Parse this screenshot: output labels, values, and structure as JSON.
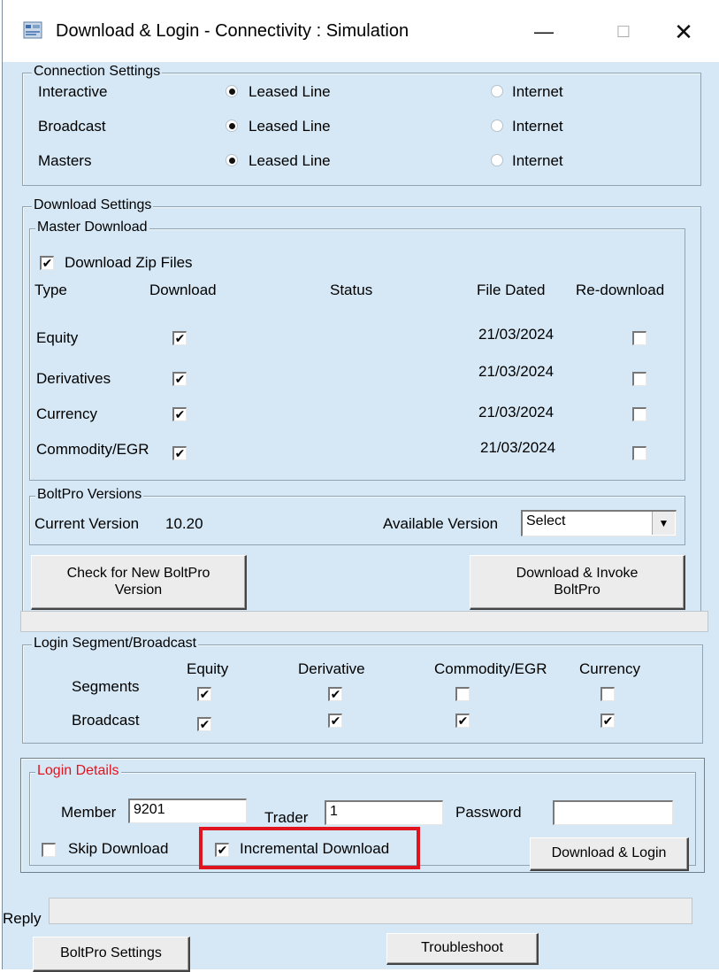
{
  "window": {
    "title": "Download & Login - Connectivity : Simulation",
    "min": "—",
    "max": "☐",
    "close": "✕"
  },
  "connection": {
    "group_label": "Connection Settings",
    "rows": [
      {
        "label": "Interactive",
        "option1": "Leased Line",
        "option2": "Internet",
        "selected": "Leased Line"
      },
      {
        "label": "Broadcast",
        "option1": "Leased Line",
        "option2": "Internet",
        "selected": "Leased Line"
      },
      {
        "label": "Masters",
        "option1": "Leased Line",
        "option2": "Internet",
        "selected": "Leased Line"
      }
    ]
  },
  "download": {
    "group_label": "Download Settings",
    "master": {
      "group_label": "Master Download",
      "zip_label": "Download Zip Files",
      "zip_checked": true,
      "headers": {
        "type": "Type",
        "download": "Download",
        "status": "Status",
        "dated": "File Dated",
        "redownload": "Re-download"
      },
      "rows": [
        {
          "type": "Equity",
          "download": true,
          "status": "",
          "dated": "21/03/2024",
          "redownload": false
        },
        {
          "type": "Derivatives",
          "download": true,
          "status": "",
          "dated": "21/03/2024",
          "redownload": false
        },
        {
          "type": "Currency",
          "download": true,
          "status": "",
          "dated": "21/03/2024",
          "redownload": false
        },
        {
          "type": "Commodity/EGR",
          "download": true,
          "status": "",
          "dated": "21/03/2024",
          "redownload": false
        }
      ]
    },
    "versions": {
      "group_label": "BoltPro Versions",
      "current_label": "Current Version",
      "current_value": "10.20",
      "available_label": "Available Version",
      "available_value": "Select"
    },
    "check_button": [
      "Check for New BoltPro",
      "Version"
    ],
    "invoke_button": [
      "Download & Invoke",
      "BoltPro"
    ]
  },
  "segments": {
    "group_label": "Login Segment/Broadcast",
    "columns": [
      "Equity",
      "Derivative",
      "Commodity/EGR",
      "Currency"
    ],
    "rows": [
      {
        "label": "Segments",
        "values": [
          true,
          true,
          false,
          false
        ]
      },
      {
        "label": "Broadcast",
        "values": [
          true,
          true,
          true,
          true
        ]
      }
    ]
  },
  "login": {
    "group_label": "Login Details",
    "member_label": "Member",
    "member_value": "9201",
    "trader_label": "Trader",
    "trader_value": "1",
    "password_label": "Password",
    "password_value": "",
    "skip_label": "Skip Download",
    "skip_checked": false,
    "incremental_label": "Incremental Download",
    "incremental_checked": true,
    "login_button": "Download & Login",
    "label_color": "#e0141e"
  },
  "reply": {
    "label": "Reply",
    "value": ""
  },
  "footer": {
    "settings_button": "BoltPro Settings",
    "troubleshoot_button": "Troubleshoot"
  },
  "colors": {
    "window_bg": "#d6e8f5",
    "highlight": "#e0141e"
  }
}
